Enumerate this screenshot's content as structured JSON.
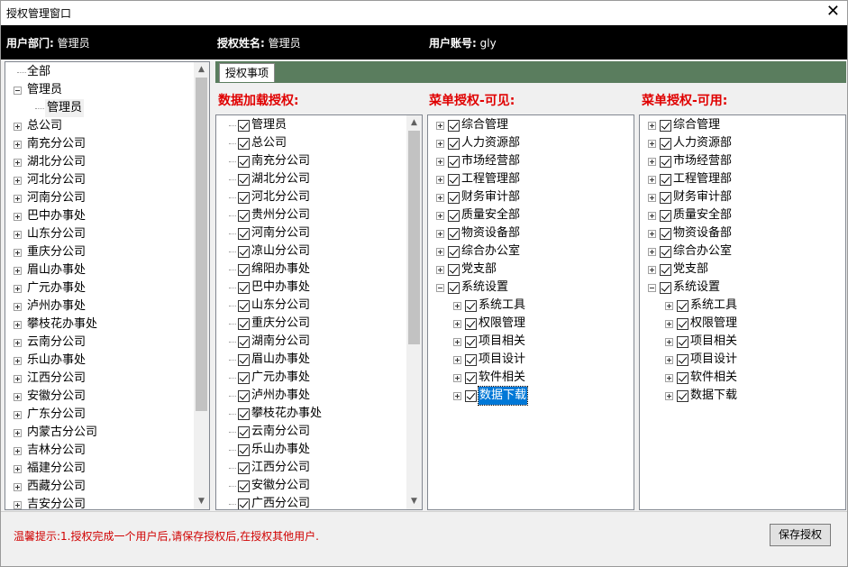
{
  "window": {
    "title": "授权管理窗口",
    "close_glyph": "✕"
  },
  "header": {
    "dept_label": "用户部门:",
    "dept_value": "管理员",
    "name_label": "授权姓名:",
    "name_value": "管理员",
    "account_label": "用户账号:",
    "account_value": "gly"
  },
  "left_tree": [
    {
      "label": "全部",
      "level": 0,
      "expander": "none"
    },
    {
      "label": "管理员",
      "level": 0,
      "expander": "minus"
    },
    {
      "label": "管理员",
      "level": 1,
      "expander": "none",
      "highlight": true
    },
    {
      "label": "总公司",
      "level": 0,
      "expander": "plus"
    },
    {
      "label": "南充分公司",
      "level": 0,
      "expander": "plus"
    },
    {
      "label": "湖北分公司",
      "level": 0,
      "expander": "plus"
    },
    {
      "label": "河北分公司",
      "level": 0,
      "expander": "plus"
    },
    {
      "label": "河南分公司",
      "level": 0,
      "expander": "plus"
    },
    {
      "label": "巴中办事处",
      "level": 0,
      "expander": "plus"
    },
    {
      "label": "山东分公司",
      "level": 0,
      "expander": "plus"
    },
    {
      "label": "重庆分公司",
      "level": 0,
      "expander": "plus"
    },
    {
      "label": "眉山办事处",
      "level": 0,
      "expander": "plus"
    },
    {
      "label": "广元办事处",
      "level": 0,
      "expander": "plus"
    },
    {
      "label": "泸州办事处",
      "level": 0,
      "expander": "plus"
    },
    {
      "label": "攀枝花办事处",
      "level": 0,
      "expander": "plus"
    },
    {
      "label": "云南分公司",
      "level": 0,
      "expander": "plus"
    },
    {
      "label": "乐山办事处",
      "level": 0,
      "expander": "plus"
    },
    {
      "label": "江西分公司",
      "level": 0,
      "expander": "plus"
    },
    {
      "label": "安徽分公司",
      "level": 0,
      "expander": "plus"
    },
    {
      "label": "广东分公司",
      "level": 0,
      "expander": "plus"
    },
    {
      "label": "内蒙古分公司",
      "level": 0,
      "expander": "plus"
    },
    {
      "label": "吉林分公司",
      "level": 0,
      "expander": "plus"
    },
    {
      "label": "福建分公司",
      "level": 0,
      "expander": "plus"
    },
    {
      "label": "西藏分公司",
      "level": 0,
      "expander": "plus"
    },
    {
      "label": "吉安分公司",
      "level": 0,
      "expander": "plus"
    }
  ],
  "tab": {
    "label": "授权事项"
  },
  "sections": {
    "data_auth": "数据加载授权:",
    "menu_visible": "菜单授权-可见:",
    "menu_usable": "菜单授权-可用:"
  },
  "data_list": [
    "管理员",
    "总公司",
    "南充分公司",
    "湖北分公司",
    "河北分公司",
    "贵州分公司",
    "河南分公司",
    "凉山分公司",
    "绵阳办事处",
    "巴中办事处",
    "山东分公司",
    "重庆分公司",
    "湖南分公司",
    "眉山办事处",
    "广元办事处",
    "泸州办事处",
    "攀枝花办事处",
    "云南分公司",
    "乐山办事处",
    "江西分公司",
    "安徽分公司",
    "广西分公司"
  ],
  "menu_visible": [
    {
      "label": "综合管理",
      "level": 0,
      "expander": "plus"
    },
    {
      "label": "人力资源部",
      "level": 0,
      "expander": "plus"
    },
    {
      "label": "市场经营部",
      "level": 0,
      "expander": "plus"
    },
    {
      "label": "工程管理部",
      "level": 0,
      "expander": "plus"
    },
    {
      "label": "财务审计部",
      "level": 0,
      "expander": "plus"
    },
    {
      "label": "质量安全部",
      "level": 0,
      "expander": "plus"
    },
    {
      "label": "物资设备部",
      "level": 0,
      "expander": "plus"
    },
    {
      "label": "综合办公室",
      "level": 0,
      "expander": "plus"
    },
    {
      "label": "党支部",
      "level": 0,
      "expander": "plus"
    },
    {
      "label": "系统设置",
      "level": 0,
      "expander": "minus"
    },
    {
      "label": "系统工具",
      "level": 1,
      "expander": "plus"
    },
    {
      "label": "权限管理",
      "level": 1,
      "expander": "plus"
    },
    {
      "label": "项目相关",
      "level": 1,
      "expander": "plus"
    },
    {
      "label": "项目设计",
      "level": 1,
      "expander": "plus"
    },
    {
      "label": "软件相关",
      "level": 1,
      "expander": "plus"
    },
    {
      "label": "数据下载",
      "level": 1,
      "expander": "plus",
      "selected": true
    }
  ],
  "menu_usable": [
    {
      "label": "综合管理",
      "level": 0,
      "expander": "plus"
    },
    {
      "label": "人力资源部",
      "level": 0,
      "expander": "plus"
    },
    {
      "label": "市场经营部",
      "level": 0,
      "expander": "plus"
    },
    {
      "label": "工程管理部",
      "level": 0,
      "expander": "plus"
    },
    {
      "label": "财务审计部",
      "level": 0,
      "expander": "plus"
    },
    {
      "label": "质量安全部",
      "level": 0,
      "expander": "plus"
    },
    {
      "label": "物资设备部",
      "level": 0,
      "expander": "plus"
    },
    {
      "label": "综合办公室",
      "level": 0,
      "expander": "plus"
    },
    {
      "label": "党支部",
      "level": 0,
      "expander": "plus"
    },
    {
      "label": "系统设置",
      "level": 0,
      "expander": "minus"
    },
    {
      "label": "系统工具",
      "level": 1,
      "expander": "plus"
    },
    {
      "label": "权限管理",
      "level": 1,
      "expander": "plus"
    },
    {
      "label": "项目相关",
      "level": 1,
      "expander": "plus"
    },
    {
      "label": "项目设计",
      "level": 1,
      "expander": "plus"
    },
    {
      "label": "软件相关",
      "level": 1,
      "expander": "plus"
    },
    {
      "label": "数据下载",
      "level": 1,
      "expander": "plus"
    }
  ],
  "footer": {
    "tip": "温馨提示:1.授权完成一个用户后,请保存授权后,在授权其他用户.",
    "save_label": "保存授权"
  },
  "colors": {
    "tab_strip": "#5a7d5e",
    "section_title": "#e00000",
    "selection": "#0078d7"
  }
}
